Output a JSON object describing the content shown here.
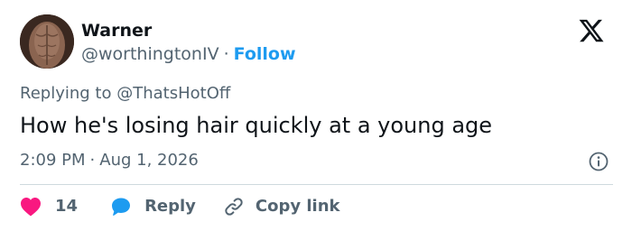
{
  "author": {
    "name": "Warner",
    "handle": "@worthingtonIV",
    "separator": "·",
    "follow_label": "Follow"
  },
  "reply_context": {
    "prefix": "Replying to",
    "mention": "@ThatsHotOff"
  },
  "tweet": {
    "text": "How he's losing hair quickly at a young age",
    "time": "2:09 PM",
    "separator": "·",
    "date": "Aug 1, 2026"
  },
  "actions": {
    "like_count": "14",
    "reply_label": "Reply",
    "copy_link_label": "Copy link"
  },
  "icons": {
    "logo": "x-logo-icon",
    "info": "info-icon",
    "like": "heart-icon",
    "reply": "speech-bubble-icon",
    "copy": "link-icon"
  },
  "colors": {
    "accent": "#1d9bf0",
    "like": "#f91880",
    "text": "#0f1419",
    "muted": "#536471",
    "divider": "#cfd9de"
  }
}
